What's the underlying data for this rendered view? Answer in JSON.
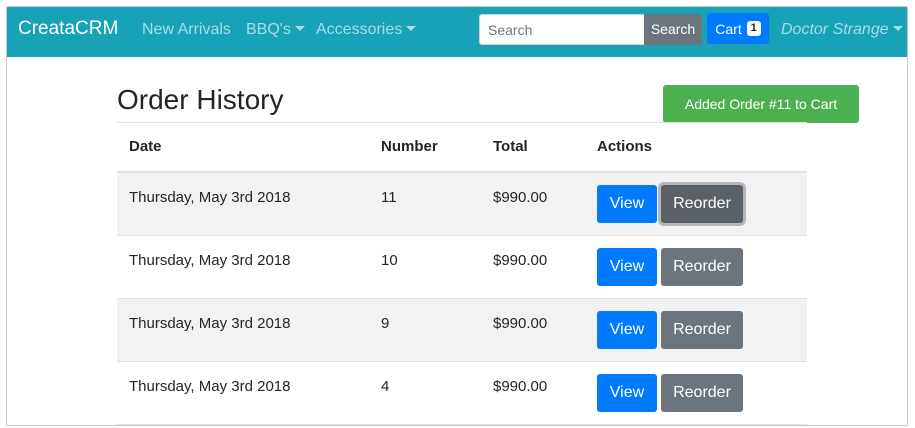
{
  "navbar": {
    "brand": "CreataCRM",
    "links": [
      {
        "label": "New Arrivals",
        "has_dropdown": false
      },
      {
        "label": "BBQ's",
        "has_dropdown": true
      },
      {
        "label": "Accessories",
        "has_dropdown": true
      }
    ],
    "search": {
      "placeholder": "Search",
      "value": "",
      "button_label": "Search"
    },
    "cart": {
      "label": "Cart",
      "count": "1"
    },
    "user": {
      "name": "Doctor Strange"
    }
  },
  "page": {
    "title": "Order History",
    "alert": "Added Order #11 to Cart"
  },
  "table": {
    "headers": {
      "date": "Date",
      "number": "Number",
      "total": "Total",
      "actions": "Actions"
    },
    "rows": [
      {
        "date": "Thursday, May 3rd 2018",
        "number": "11",
        "total": "$990.00",
        "view_label": "View",
        "reorder_label": "Reorder"
      },
      {
        "date": "Thursday, May 3rd 2018",
        "number": "10",
        "total": "$990.00",
        "view_label": "View",
        "reorder_label": "Reorder"
      },
      {
        "date": "Thursday, May 3rd 2018",
        "number": "9",
        "total": "$990.00",
        "view_label": "View",
        "reorder_label": "Reorder"
      },
      {
        "date": "Thursday, May 3rd 2018",
        "number": "4",
        "total": "$990.00",
        "view_label": "View",
        "reorder_label": "Reorder"
      }
    ]
  },
  "colors": {
    "navbar": "#17a2b8",
    "primary": "#007bff",
    "secondary": "#6c757d",
    "success": "#4caf50"
  }
}
